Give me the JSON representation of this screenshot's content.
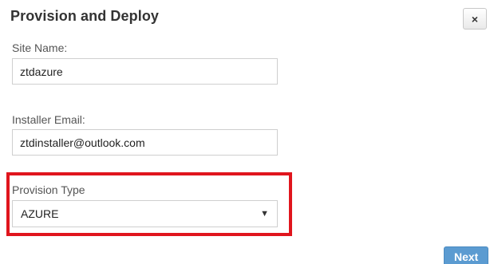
{
  "dialog": {
    "title": "Provision and Deploy",
    "close_icon": "close-icon",
    "close_glyph": "×"
  },
  "form": {
    "site_name": {
      "label": "Site Name:",
      "value": "ztdazure"
    },
    "installer_email": {
      "label": "Installer Email:",
      "value": "ztdinstaller@outlook.com"
    },
    "provision_type": {
      "label": "Provision Type",
      "selected": "AZURE",
      "arrow_icon": "caret-down-icon",
      "arrow_glyph": "▼"
    }
  },
  "footer": {
    "next_label": "Next"
  },
  "colors": {
    "highlight": "#e0151d",
    "primary_button": "#5b9bd1"
  }
}
